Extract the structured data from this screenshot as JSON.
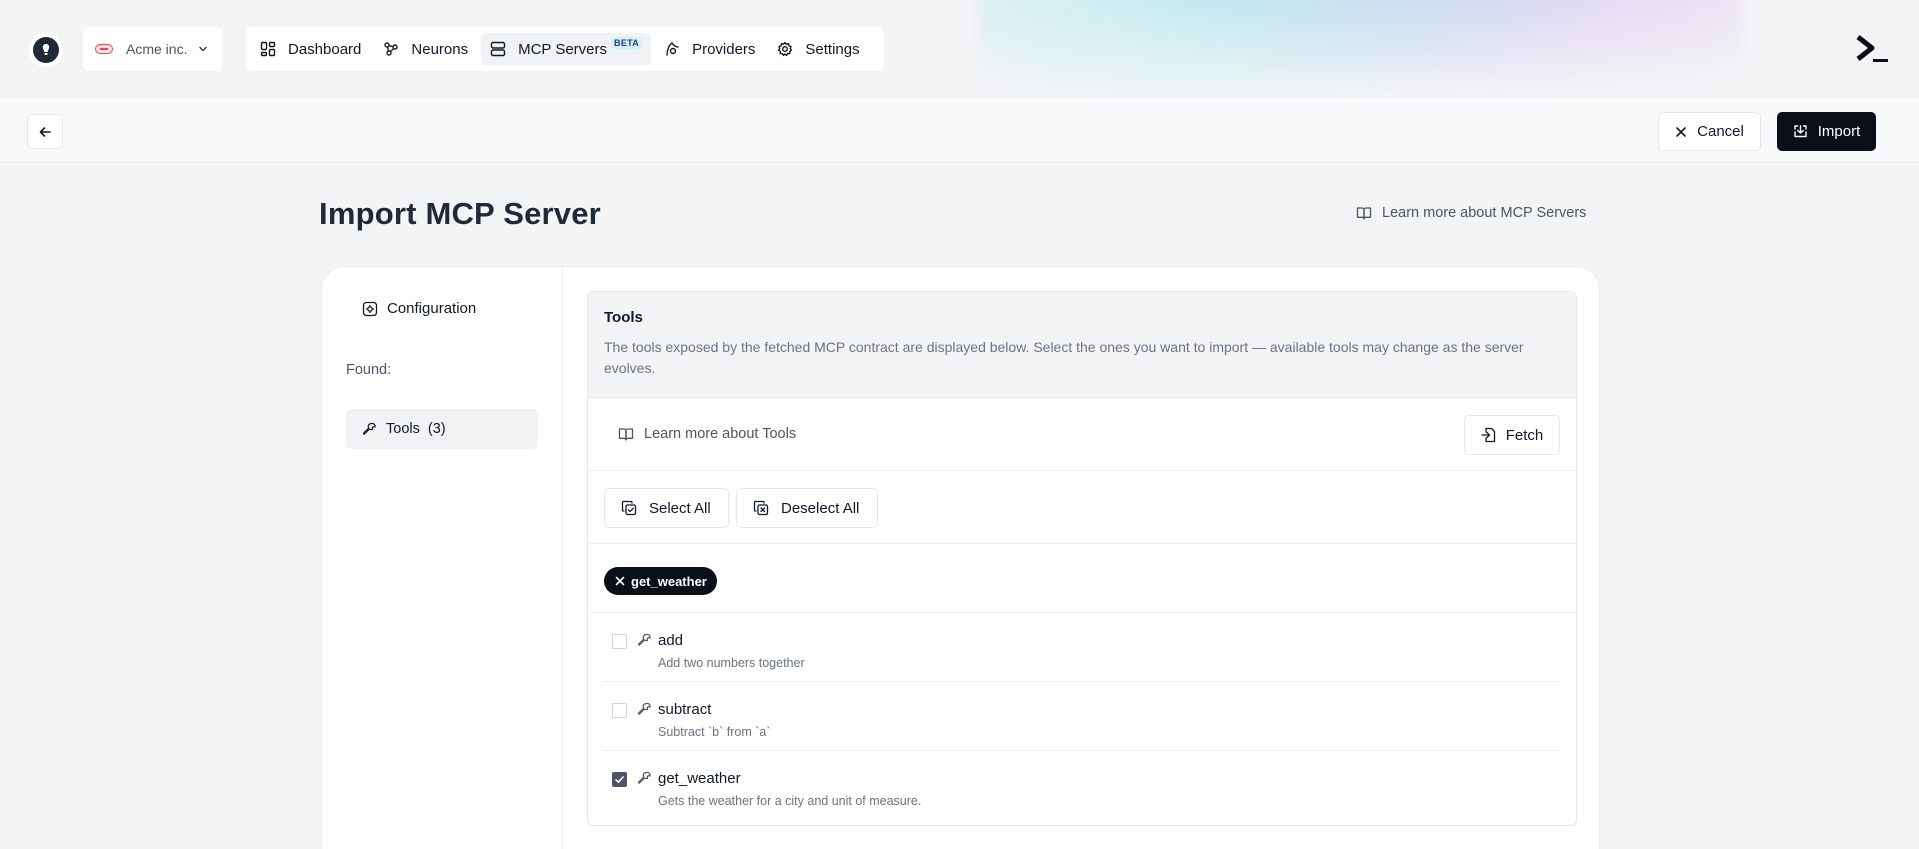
{
  "org": {
    "name": "Acme inc."
  },
  "nav": {
    "items": [
      {
        "label": "Dashboard",
        "icon": "dashboard-icon"
      },
      {
        "label": "Neurons",
        "icon": "neurons-icon"
      },
      {
        "label": "MCP Servers",
        "icon": "server-icon",
        "badge": "BETA",
        "active": true
      },
      {
        "label": "Providers",
        "icon": "providers-icon"
      },
      {
        "label": "Settings",
        "icon": "gear-icon"
      }
    ]
  },
  "actions": {
    "cancel_label": "Cancel",
    "import_label": "Import"
  },
  "page": {
    "title": "Import MCP Server",
    "learn_more": "Learn more about MCP Servers"
  },
  "sidebar": {
    "configuration_label": "Configuration",
    "found_label": "Found:",
    "tools_label": "Tools",
    "tools_count": "(3)"
  },
  "tools": {
    "title": "Tools",
    "description": "The tools exposed by the fetched MCP contract are displayed below. Select the ones you want to import — available tools may change as the server evolves.",
    "learn_more": "Learn more about Tools",
    "fetch_label": "Fetch",
    "select_all_label": "Select All",
    "deselect_all_label": "Deselect All",
    "selected_chips": [
      "get_weather"
    ],
    "items": [
      {
        "name": "add",
        "description": "Add two numbers together",
        "checked": false
      },
      {
        "name": "subtract",
        "description": "Subtract `b` from `a`",
        "checked": false
      },
      {
        "name": "get_weather",
        "description": "Gets the weather for a city and unit of measure.",
        "checked": true
      }
    ]
  },
  "colors": {
    "primary": "#0b0f19",
    "background": "#f3f4f6",
    "muted_text": "#6b7280"
  }
}
